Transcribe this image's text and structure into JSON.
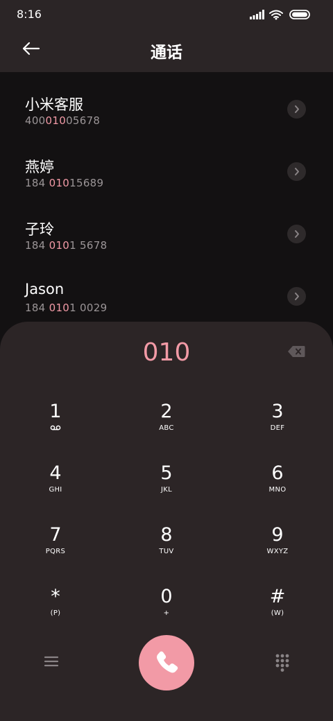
{
  "status_bar": {
    "time": "8:16"
  },
  "header": {
    "title": "通话",
    "back_icon": "arrow-left-icon"
  },
  "contacts": [
    {
      "name": "小米客服",
      "number_pre": "400",
      "number_match": "010",
      "number_post": "05678"
    },
    {
      "name": "燕婷",
      "number_pre": "184 ",
      "number_match": "010",
      "number_post": "15689"
    },
    {
      "name": "子玲",
      "number_pre": "184 ",
      "number_match": "010",
      "number_post": "1 5678"
    },
    {
      "name": "Jason",
      "number_pre": "184 ",
      "number_match": "010",
      "number_post": "1 0029"
    }
  ],
  "dialpad": {
    "dialed": "010",
    "keys": [
      {
        "digit": "1",
        "letters": ""
      },
      {
        "digit": "2",
        "letters": "ABC"
      },
      {
        "digit": "3",
        "letters": "DEF"
      },
      {
        "digit": "4",
        "letters": "GHI"
      },
      {
        "digit": "5",
        "letters": "JKL"
      },
      {
        "digit": "6",
        "letters": "MNO"
      },
      {
        "digit": "7",
        "letters": "PQRS"
      },
      {
        "digit": "8",
        "letters": "TUV"
      },
      {
        "digit": "9",
        "letters": "WXYZ"
      },
      {
        "digit": "*",
        "letters": "(P)"
      },
      {
        "digit": "0",
        "letters": "+"
      },
      {
        "digit": "#",
        "letters": "(W)"
      }
    ]
  },
  "colors": {
    "accent": "#f29aa6",
    "background": "#131112",
    "panel": "#2c2526"
  }
}
